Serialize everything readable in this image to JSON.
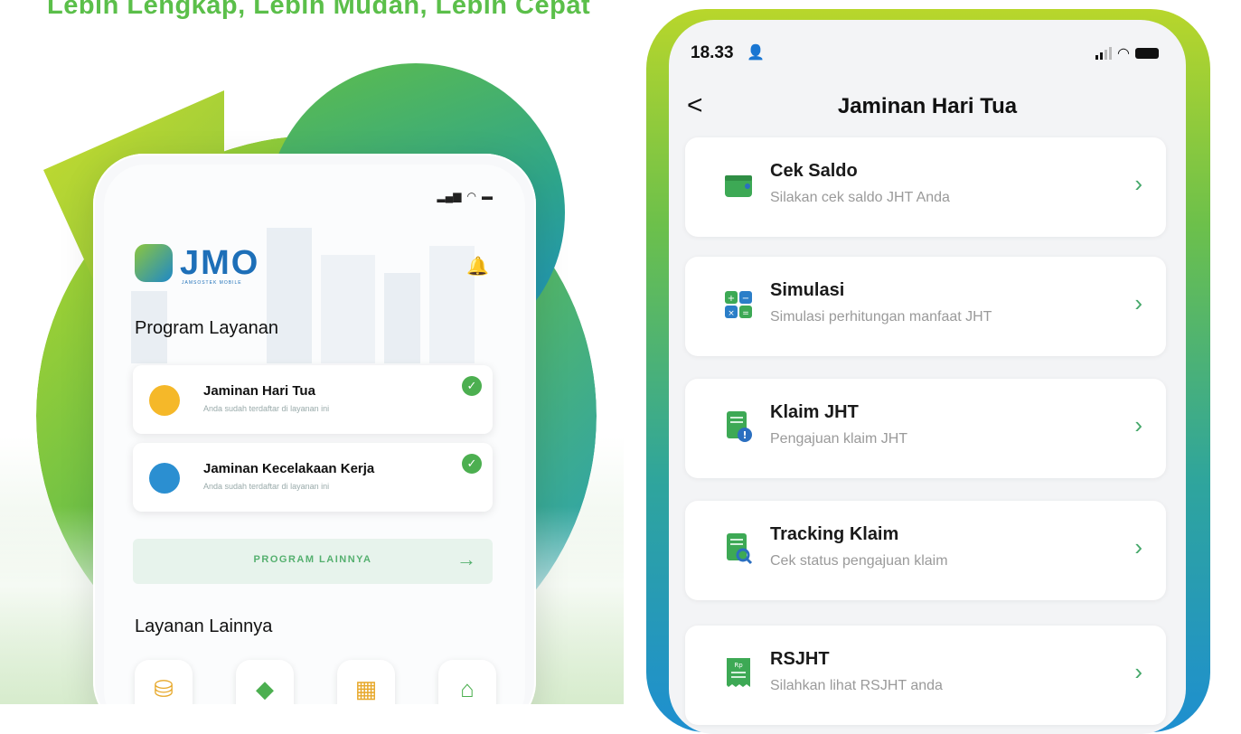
{
  "promo": {
    "tagline": "Lebih Lengkap, Lebih Mudah, Lebih Cepat"
  },
  "left_phone": {
    "logo_text": "JMO",
    "logo_subtext": "JAMSOSTEK MOBILE",
    "section_title": "Program Layanan",
    "programs": [
      {
        "title": "Jaminan Hari Tua",
        "subtitle": "Anda sudah terdaftar di layanan ini",
        "icon": "hand-coin-icon"
      },
      {
        "title": "Jaminan Kecelakaan Kerja",
        "subtitle": "Anda sudah terdaftar di layanan ini",
        "icon": "worker-shield-icon"
      }
    ],
    "more_label": "PROGRAM LAINNYA",
    "other_section_title": "Layanan Lainnya",
    "tiles": [
      "plant-coin-icon",
      "money-transfer-icon",
      "organization-icon",
      "shop-icon"
    ]
  },
  "right_phone": {
    "status_time": "18.33",
    "title": "Jaminan Hari Tua",
    "menu": [
      {
        "title": "Cek Saldo",
        "subtitle": "Silakan cek saldo JHT Anda",
        "icon": "wallet-icon"
      },
      {
        "title": "Simulasi",
        "subtitle": "Simulasi perhitungan manfaat JHT",
        "icon": "calculator-icon"
      },
      {
        "title": "Klaim JHT",
        "subtitle": "Pengajuan klaim JHT",
        "icon": "claim-document-icon"
      },
      {
        "title": "Tracking Klaim",
        "subtitle": "Cek status pengajuan klaim",
        "icon": "search-document-icon"
      },
      {
        "title": "RSJHT",
        "subtitle": "Silahkan lihat RSJHT anda",
        "icon": "receipt-icon"
      }
    ]
  },
  "colors": {
    "brand_green": "#4caf50",
    "brand_blue": "#1d6fb8",
    "chevron": "#45a86a",
    "gradient_top": "#b8d62b",
    "gradient_bottom": "#1e8fd0"
  }
}
